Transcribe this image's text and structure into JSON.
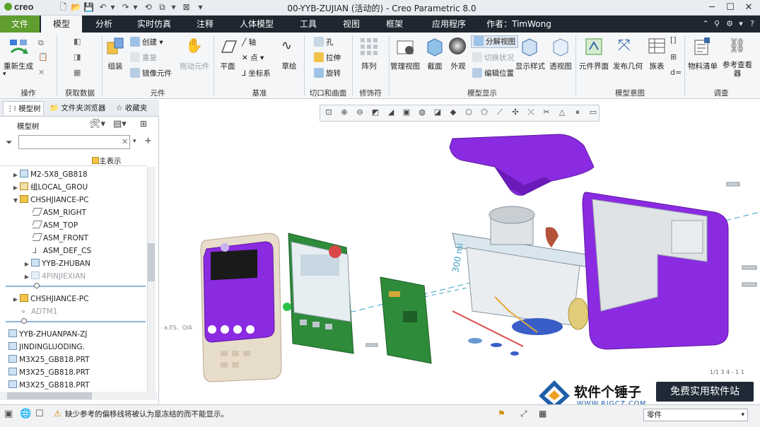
{
  "app": {
    "logo": "creo",
    "window_title": "00-YYB-ZUJIAN (活动的) - Creo Parametric 8.0"
  },
  "tabs": [
    "文件",
    "模型",
    "分析",
    "实时仿真",
    "注释",
    "人体模型",
    "工具",
    "视图",
    "框架",
    "应用程序"
  ],
  "author": "作者：TimWong",
  "ribbon": {
    "groups": {
      "operations": "操作",
      "get_data": "获取数据",
      "components": "元件",
      "datum": "基准",
      "cut_surface": "切口和曲面",
      "modifiers": "修饰符",
      "model_display": "模型显示",
      "model_intent": "模型意图",
      "investigate": "调查"
    },
    "buttons": {
      "regenerate": "重新生成",
      "assemble": "组装",
      "create": "创建",
      "repeat": "重复",
      "mirror_component": "镜像元件",
      "drag_components": "拖动元件",
      "plane": "平面",
      "axis": "轴",
      "point": "点",
      "csys": "坐标系",
      "sketch": "草绘",
      "hole": "孔",
      "extrude": "拉伸",
      "revolve": "旋转",
      "pattern": "阵列",
      "manage_views": "管理视图",
      "section": "截面",
      "appearance": "外观",
      "exploded_view": "分解视图",
      "toggle_status": "切换状况",
      "edit_position": "编辑位置",
      "display_style": "显示样式",
      "perspective": "透视图",
      "component_interface": "元件界面",
      "publish_geometry": "发布几何",
      "family_table": "族表",
      "bom": "物料清单",
      "reference_viewer": "参考查看器"
    }
  },
  "left_panel": {
    "tabs": [
      "模型树",
      "文件夹浏览器",
      "收藏夹"
    ],
    "tree_title": "模型树",
    "search_placeholder": "",
    "main_representation": "主表示",
    "tree_items": [
      "M2-5X8_GB818",
      "组LOCAL_GROU",
      "CHSHJIANCE-PC",
      "ASM_RIGHT",
      "ASM_TOP",
      "ASM_FRONT",
      "ASM_DEF_CS",
      "YYB-ZHUBAN",
      "4PINJIEXIAN",
      "CHSHJIANCE-PC",
      "ADTM1",
      "YYB-ZHUANPAN-ZJ",
      "JINDINGLUODING.",
      "M3X25_GB818.PRT",
      "M3X25_GB818.PRT",
      "M3X25_GB818.PRT"
    ]
  },
  "graphics": {
    "labels": [
      "1/1 3 4 - 1 1"
    ],
    "colors": {
      "housing": "#8a2be2",
      "board": "#2e8b3a",
      "face": "#e8dccb"
    }
  },
  "status": {
    "message": "缺少参考的偏移线将被认为是冻结的而不能显示。",
    "filter_value": "零件"
  },
  "watermark": {
    "name": "软件个锤子",
    "url": "WWW.RJGCZ.COM",
    "slogan": "免费实用软件站"
  }
}
